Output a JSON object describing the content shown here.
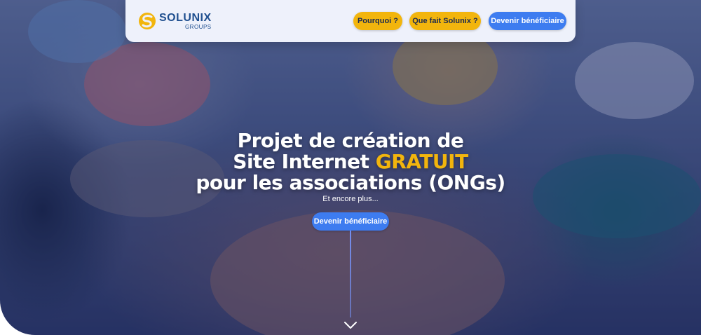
{
  "brand": {
    "name": "SOLUNIX",
    "sub": "GROUPS",
    "primary_color": "#1f4f8f",
    "accent_color": "#f2b50d"
  },
  "nav": {
    "items": [
      {
        "label": "Pourquoi ?",
        "style": "yellow"
      },
      {
        "label": "Que fait Solunix ?",
        "style": "yellow"
      },
      {
        "label": "Devenir bénéficiaire",
        "style": "blue"
      }
    ]
  },
  "hero": {
    "title_line1": "Projet de création de",
    "title_line2_prefix": "Site Internet",
    "title_line2_highlight": "GRATUIT",
    "title_line3": "pour les associations (ONGs)",
    "subtitle": "Et encore plus...",
    "cta_label": "Devenir bénéficiaire",
    "scroll_icon": "chevron-down-icon"
  },
  "colors": {
    "button_yellow": "#f2b50d",
    "button_blue": "#3d7cf0",
    "header_bg": "#eef1fb"
  }
}
